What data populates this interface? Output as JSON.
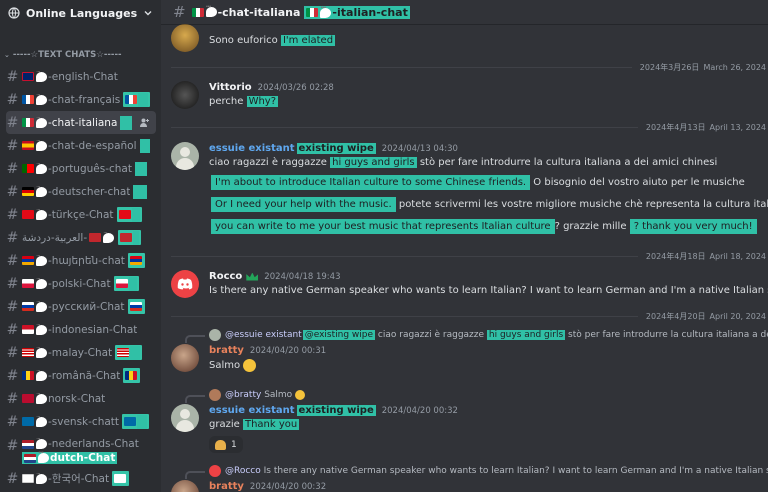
{
  "server": {
    "name": "Online Languages"
  },
  "category": {
    "label": "-----☆TEXT CHATS☆-----"
  },
  "channels": [
    {
      "label": "-english-Chat",
      "flag": "uk"
    },
    {
      "label": "-chat-français",
      "flag": "fr"
    },
    {
      "label": "-chat-italiana",
      "flag": "it"
    },
    {
      "label": "-chat-de-español",
      "flag": "es"
    },
    {
      "label": "-português-chat",
      "flag": "pt"
    },
    {
      "label": "-deutscher-chat",
      "flag": "de"
    },
    {
      "label": "-türkçe-Chat",
      "flag": "tr"
    },
    {
      "label": "العربية-دردشة-",
      "flag": "ma"
    },
    {
      "label": "-հայերեն-chat",
      "flag": "am"
    },
    {
      "label": "-polski-Chat",
      "flag": "pl"
    },
    {
      "label": "-русский-Chat",
      "flag": "ru"
    },
    {
      "label": "-indonesian-Chat",
      "flag": "id"
    },
    {
      "label": "-malay-Chat",
      "flag": "my"
    },
    {
      "label": "-română-Chat",
      "flag": "ro"
    },
    {
      "label": "norsk-Chat",
      "flag": "no"
    },
    {
      "label": "-svensk-chatt",
      "flag": "se"
    },
    {
      "label": "-nederlands-Chat",
      "flag": "nl",
      "translation": "dutch-Chat"
    },
    {
      "label": "-한국어-Chat",
      "flag": "kr"
    }
  ],
  "topbar": {
    "channel": "-chat-italiana",
    "translation": "-italian-chat"
  },
  "messages": {
    "m0": {
      "text": "Sono euforico",
      "translation": "I'm elated"
    },
    "d1": {
      "date": "2024年3月26日",
      "translation": "March 26, 2024"
    },
    "m1": {
      "author": "Vittorio",
      "timestamp": "2024/03/26 02:28",
      "text": "perche",
      "translation": "Why?"
    },
    "d2": {
      "date": "2024年4月13日",
      "translation": "April 13, 2024"
    },
    "m2": {
      "author": "essuie existant",
      "author_translation": "existing wipe",
      "timestamp": "2024/04/13 04:30",
      "l1a": "ciao ragazzi è raggazze",
      "l1b": "hi guys and girls",
      "l1c": "stò per fare introdurre la cultura italiana a dei amici chinesi",
      "l2a": "I'm about to introduce Italian culture to some Chinese friends.",
      "l2b": "O bisognio del vostro aiuto per le musiche",
      "l3a": "Or I need your help with the music.",
      "l3b": "potete scrivermi les vostre migliore musiche chè representa la cultura italiana",
      "l4a": "you can write to me your best music that represents Italian culture",
      "l4b": "? grazzie mille",
      "l4c": "?  thank you very much!"
    },
    "d3": {
      "date": "2024年4月18日",
      "translation": "April 18, 2024"
    },
    "m3": {
      "author": "Rocco",
      "timestamp": "2024/04/18 19:43",
      "text": "Is there any native German speaker who wants to learn Italian? I want to learn German and I'm a native Italian speaker, we ca"
    },
    "d4": {
      "date": "2024年4月20日",
      "translation": "April 20, 2024"
    },
    "m4": {
      "reply_author": "@essuie existant",
      "reply_author_translation": "@existing wipe",
      "reply_text_a": "ciao ragazzi è raggazze",
      "reply_text_b": "hi guys and girls",
      "reply_text_c": "stò per fare introdurre la cultura italiana a dei amici chinesi...",
      "author": "bratty",
      "timestamp": "2024/04/20 00:31",
      "text": "Salmo"
    },
    "m5": {
      "reply_author": "@bratty",
      "reply_text": "Salmo",
      "author": "essuie existant",
      "author_translation": "existing wipe",
      "timestamp": "2024/04/20 00:32",
      "text": "grazie",
      "translation": "Thank you",
      "reaction_count": "1"
    },
    "m6": {
      "reply_author": "@Rocco",
      "reply_text": "Is there any native German speaker who wants to learn Italian? I want to learn German and I'm a native Italian speaker, we can hel",
      "author": "bratty",
      "timestamp": "2024/04/20 00:32"
    }
  },
  "colors": {
    "highlight": "#30c0a6",
    "essuie": "#5fa8f0",
    "bratty": "#e8825c",
    "rocco": "#ed4245"
  }
}
